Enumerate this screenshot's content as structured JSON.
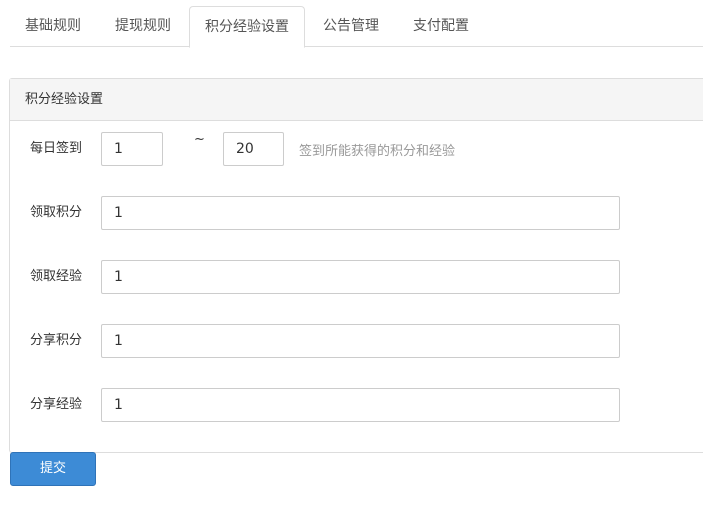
{
  "tabs": [
    {
      "label": "基础规则",
      "active": false
    },
    {
      "label": "提现规则",
      "active": false
    },
    {
      "label": "积分经验设置",
      "active": true
    },
    {
      "label": "公告管理",
      "active": false
    },
    {
      "label": "支付配置",
      "active": false
    }
  ],
  "panel": {
    "title": "积分经验设置",
    "daily_signin": {
      "label": "每日签到",
      "min_value": "1",
      "separator": "~",
      "max_value": "20",
      "help": "签到所能获得的积分和经验"
    },
    "fields": [
      {
        "label": "领取积分",
        "value": "1"
      },
      {
        "label": "领取经验",
        "value": "1"
      },
      {
        "label": "分享积分",
        "value": "1"
      },
      {
        "label": "分享经验",
        "value": "1"
      }
    ]
  },
  "submit_label": "提交",
  "colors": {
    "primary_button": "#3d8bd6",
    "panel_heading_bg": "#f5f5f5",
    "border": "#dddddd",
    "help_text": "#999999"
  }
}
